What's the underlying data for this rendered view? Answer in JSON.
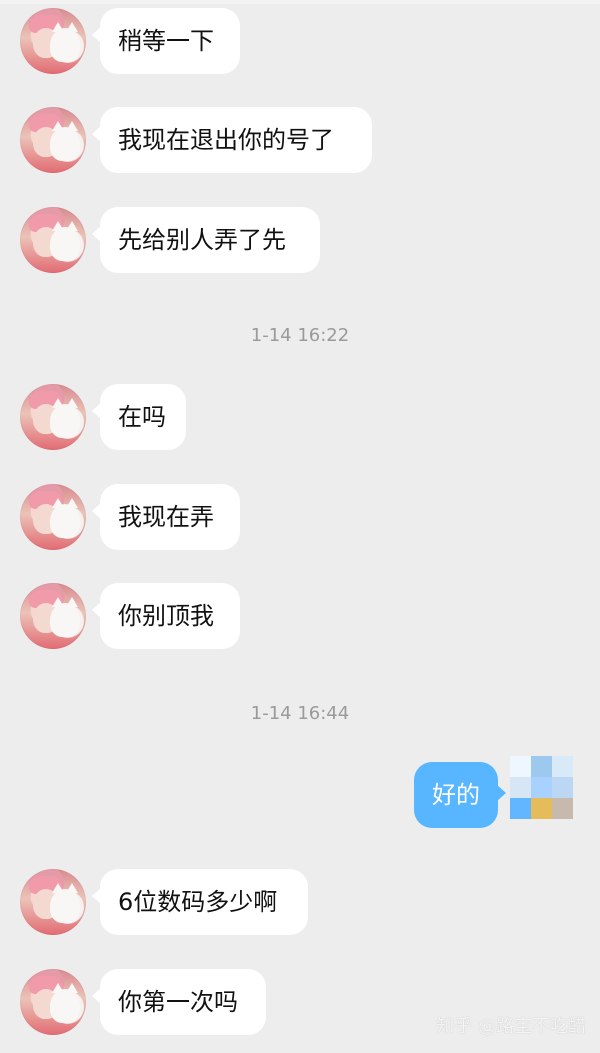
{
  "messages": [
    {
      "text": "稍等一下"
    },
    {
      "text": "我现在退出你的号了"
    },
    {
      "text": "先给别人弄了先"
    },
    {
      "text": "在吗"
    },
    {
      "text": "我现在弄"
    },
    {
      "text": "你别顶我"
    },
    {
      "text": "6位数码多少啊"
    },
    {
      "text": "你第一次吗"
    }
  ],
  "timestamps": [
    "1-14 16:22",
    "1-14 16:44"
  ],
  "my_message": "好的",
  "watermark": "知乎 @路宝不吃醋",
  "colors": {
    "background": "#ededed",
    "incoming_bubble": "#ffffff",
    "outgoing_bubble": "#58b5ff",
    "timestamp": "#9a9a9a"
  },
  "icons": {
    "contact_avatar": "profile-photo-avatar",
    "my_avatar": "pixelated-avatar"
  }
}
